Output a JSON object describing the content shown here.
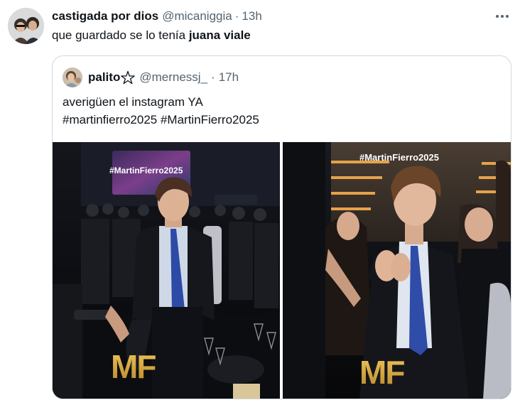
{
  "tweet": {
    "author_name": "castigada por dios",
    "author_handle": "@micaniggia",
    "separator": "·",
    "time": "13h",
    "text_prefix": "que guardado se lo tenía ",
    "text_bold": "juana viale",
    "more_icon": "more-horizontal-icon"
  },
  "quoted": {
    "author_name": "palito",
    "author_badge_icon": "pentagram-icon",
    "author_handle": "@mernessj_",
    "separator": "·",
    "time": "17h",
    "text_line1": "averigüen el instagram YA",
    "text_line2": "#martinfierro2025 #MartinFierro2025"
  },
  "media": {
    "left_screen_text": "#MartinFierro2025",
    "left_logo_text": "MF",
    "right_screen_text": "#MartinFierro2025",
    "right_logo_text": "MF"
  },
  "colors": {
    "text_primary": "#0f1419",
    "text_secondary": "#536471",
    "border": "#cfd9de",
    "gold": "#d9a93a"
  }
}
